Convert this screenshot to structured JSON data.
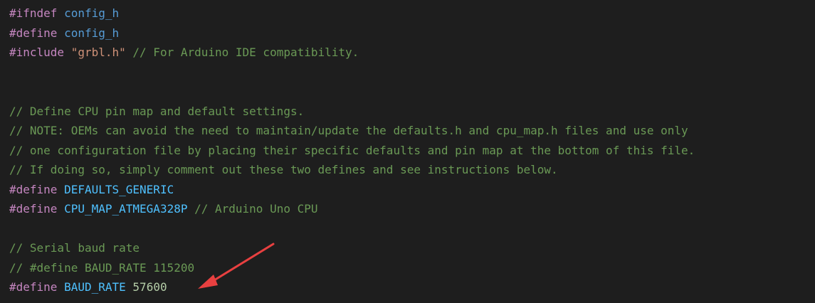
{
  "colors": {
    "background": "#1e1e1e",
    "directive": "#c586c0",
    "identifier": "#569cd6",
    "macro": "#4fc1ff",
    "string": "#ce9178",
    "comment": "#6a9955",
    "number": "#b5cea8",
    "annotation_arrow": "#e84040"
  },
  "code": {
    "line1": {
      "directive": "#ifndef",
      "ident": "config_h"
    },
    "line2": {
      "directive": "#define",
      "ident": "config_h"
    },
    "line3": {
      "directive": "#include",
      "string": "\"grbl.h\"",
      "comment": "// For Arduino IDE compatibility."
    },
    "line6": {
      "comment": "// Define CPU pin map and default settings."
    },
    "line7": {
      "comment": "// NOTE: OEMs can avoid the need to maintain/update the defaults.h and cpu_map.h files and use only"
    },
    "line8": {
      "comment": "// one configuration file by placing their specific defaults and pin map at the bottom of this file."
    },
    "line9": {
      "comment": "// If doing so, simply comment out these two defines and see instructions below."
    },
    "line10": {
      "directive": "#define",
      "macro": "DEFAULTS_GENERIC"
    },
    "line11": {
      "directive": "#define",
      "macro": "CPU_MAP_ATMEGA328P",
      "comment": "// Arduino Uno CPU"
    },
    "line13": {
      "comment": "// Serial baud rate"
    },
    "line14": {
      "comment": "// #define BAUD_RATE 115200"
    },
    "line15": {
      "directive": "#define",
      "macro": "BAUD_RATE",
      "number": "57600"
    }
  }
}
